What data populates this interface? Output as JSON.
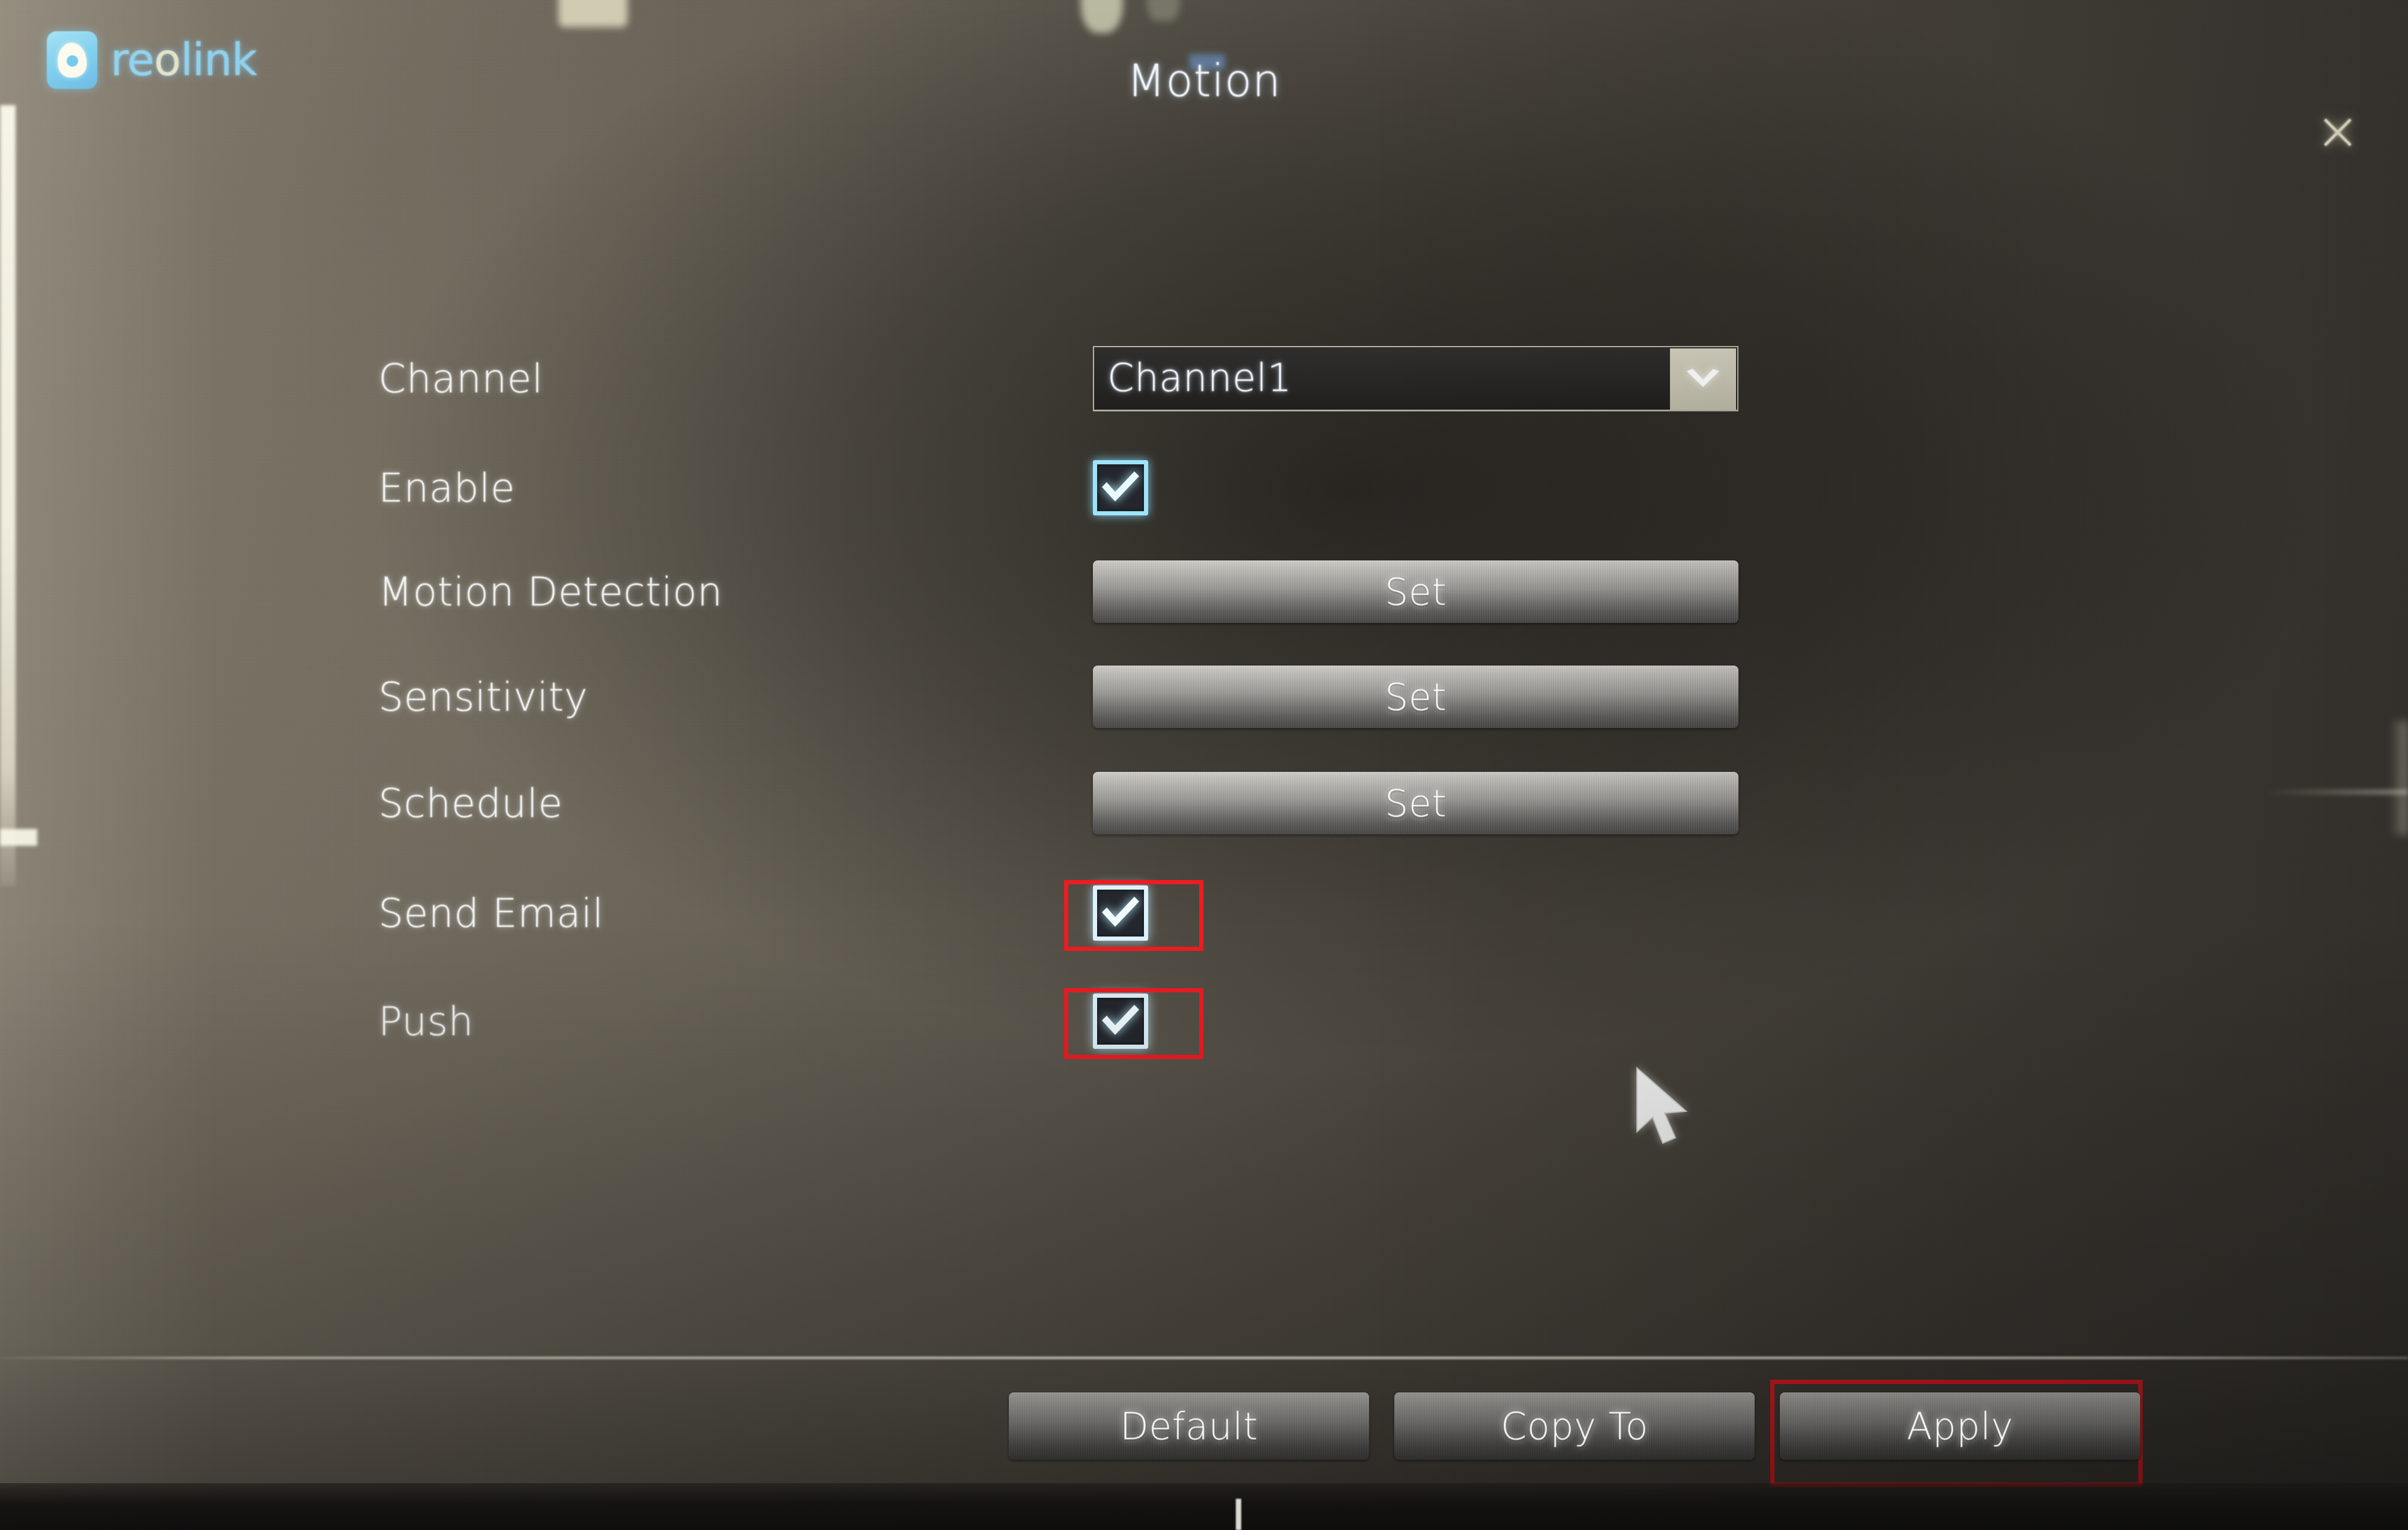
{
  "brand": {
    "name_part1": "re",
    "name_accent": "o",
    "name_part2": "link",
    "icon": "reolink-logo-icon"
  },
  "header": {
    "title": "Motion",
    "close_label": "×",
    "close_icon": "close-icon"
  },
  "form": {
    "rows": [
      {
        "label": "Channel",
        "control": "select",
        "value": "Channel1",
        "arrow_icon": "chevron-down-icon"
      },
      {
        "label": "Enable",
        "control": "checkbox",
        "checked": true,
        "highlighted": false
      },
      {
        "label": "Motion Detection",
        "control": "button",
        "button_label": "Set"
      },
      {
        "label": "Sensitivity",
        "control": "button",
        "button_label": "Set"
      },
      {
        "label": "Schedule",
        "control": "button",
        "button_label": "Set"
      },
      {
        "label": "Send Email",
        "control": "checkbox",
        "checked": true,
        "highlighted": true
      },
      {
        "label": "Push",
        "control": "checkbox",
        "checked": true,
        "highlighted": true
      }
    ]
  },
  "footer": {
    "buttons": [
      {
        "label": "Default",
        "highlighted": false
      },
      {
        "label": "Copy To",
        "highlighted": false
      },
      {
        "label": "Apply",
        "highlighted": true
      }
    ]
  },
  "cursor": {
    "icon": "mouse-pointer-icon"
  },
  "colors": {
    "annotation": "#ee1c22",
    "brand_blue": "#8ed2f0",
    "checkbox_border": "#9ee4fb",
    "background": "#5c584f",
    "dropdown_arrow_bg": "#c9c6b4"
  }
}
